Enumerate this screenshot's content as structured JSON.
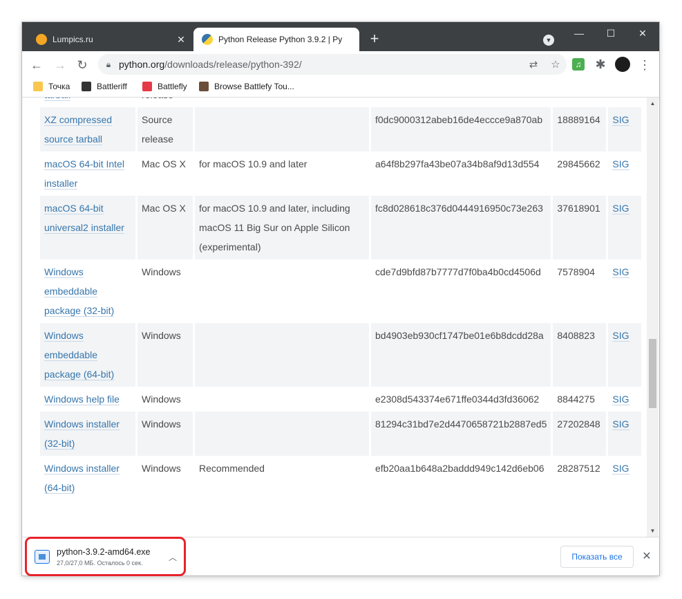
{
  "tabs": [
    {
      "title": "Lumpics.ru",
      "favicon_color": "#f5a623",
      "active": false
    },
    {
      "title": "Python Release Python 3.9.2 | Py",
      "favicon_color": "#3776ab",
      "active": true
    }
  ],
  "address": {
    "host": "python.org",
    "path": "/downloads/release/python-392/"
  },
  "bookmarks": [
    {
      "label": "Точка",
      "icon_color": "#f9c74f"
    },
    {
      "label": "Battleriff",
      "icon_color": "#333333"
    },
    {
      "label": "Battlefly",
      "icon_color": "#e63946"
    },
    {
      "label": "Browse Battlefy Tou...",
      "icon_color": "#6b4f3a"
    }
  ],
  "table": {
    "rows": [
      {
        "name": "tarball",
        "os": "release",
        "description": "",
        "md5": "",
        "size": "",
        "sig": ""
      },
      {
        "name": "XZ compressed source tarball",
        "os": "Source release",
        "description": "",
        "md5": "f0dc9000312abeb16de4eccce9a870ab",
        "size": "18889164",
        "sig": "SIG"
      },
      {
        "name": "macOS 64-bit Intel installer",
        "os": "Mac OS X",
        "description": "for macOS 10.9 and later",
        "md5": "a64f8b297fa43be07a34b8af9d13d554",
        "size": "29845662",
        "sig": "SIG"
      },
      {
        "name": "macOS 64-bit universal2 installer",
        "os": "Mac OS X",
        "description": "for macOS 10.9 and later, including macOS 11 Big Sur on Apple Silicon (experimental)",
        "md5": "fc8d028618c376d0444916950c73e263",
        "size": "37618901",
        "sig": "SIG"
      },
      {
        "name": "Windows embeddable package (32-bit)",
        "os": "Windows",
        "description": "",
        "md5": "cde7d9bfd87b7777d7f0ba4b0cd4506d",
        "size": "7578904",
        "sig": "SIG"
      },
      {
        "name": "Windows embeddable package (64-bit)",
        "os": "Windows",
        "description": "",
        "md5": "bd4903eb930cf1747be01e6b8dcdd28a",
        "size": "8408823",
        "sig": "SIG"
      },
      {
        "name": "Windows help file",
        "os": "Windows",
        "description": "",
        "md5": "e2308d543374e671ffe0344d3fd36062",
        "size": "8844275",
        "sig": "SIG"
      },
      {
        "name": "Windows installer (32-bit)",
        "os": "Windows",
        "description": "",
        "md5": "81294c31bd7e2d4470658721b2887ed5",
        "size": "27202848",
        "sig": "SIG"
      },
      {
        "name": "Windows installer (64-bit)",
        "os": "Windows",
        "description": "Recommended",
        "md5": "efb20aa1b648a2baddd949c142d6eb06",
        "size": "28287512",
        "sig": "SIG"
      }
    ]
  },
  "download": {
    "filename": "python-3.9.2-amd64.exe",
    "status": "27,0/27,0 МБ. Осталось 0 сек.",
    "show_all_label": "Показать все"
  }
}
